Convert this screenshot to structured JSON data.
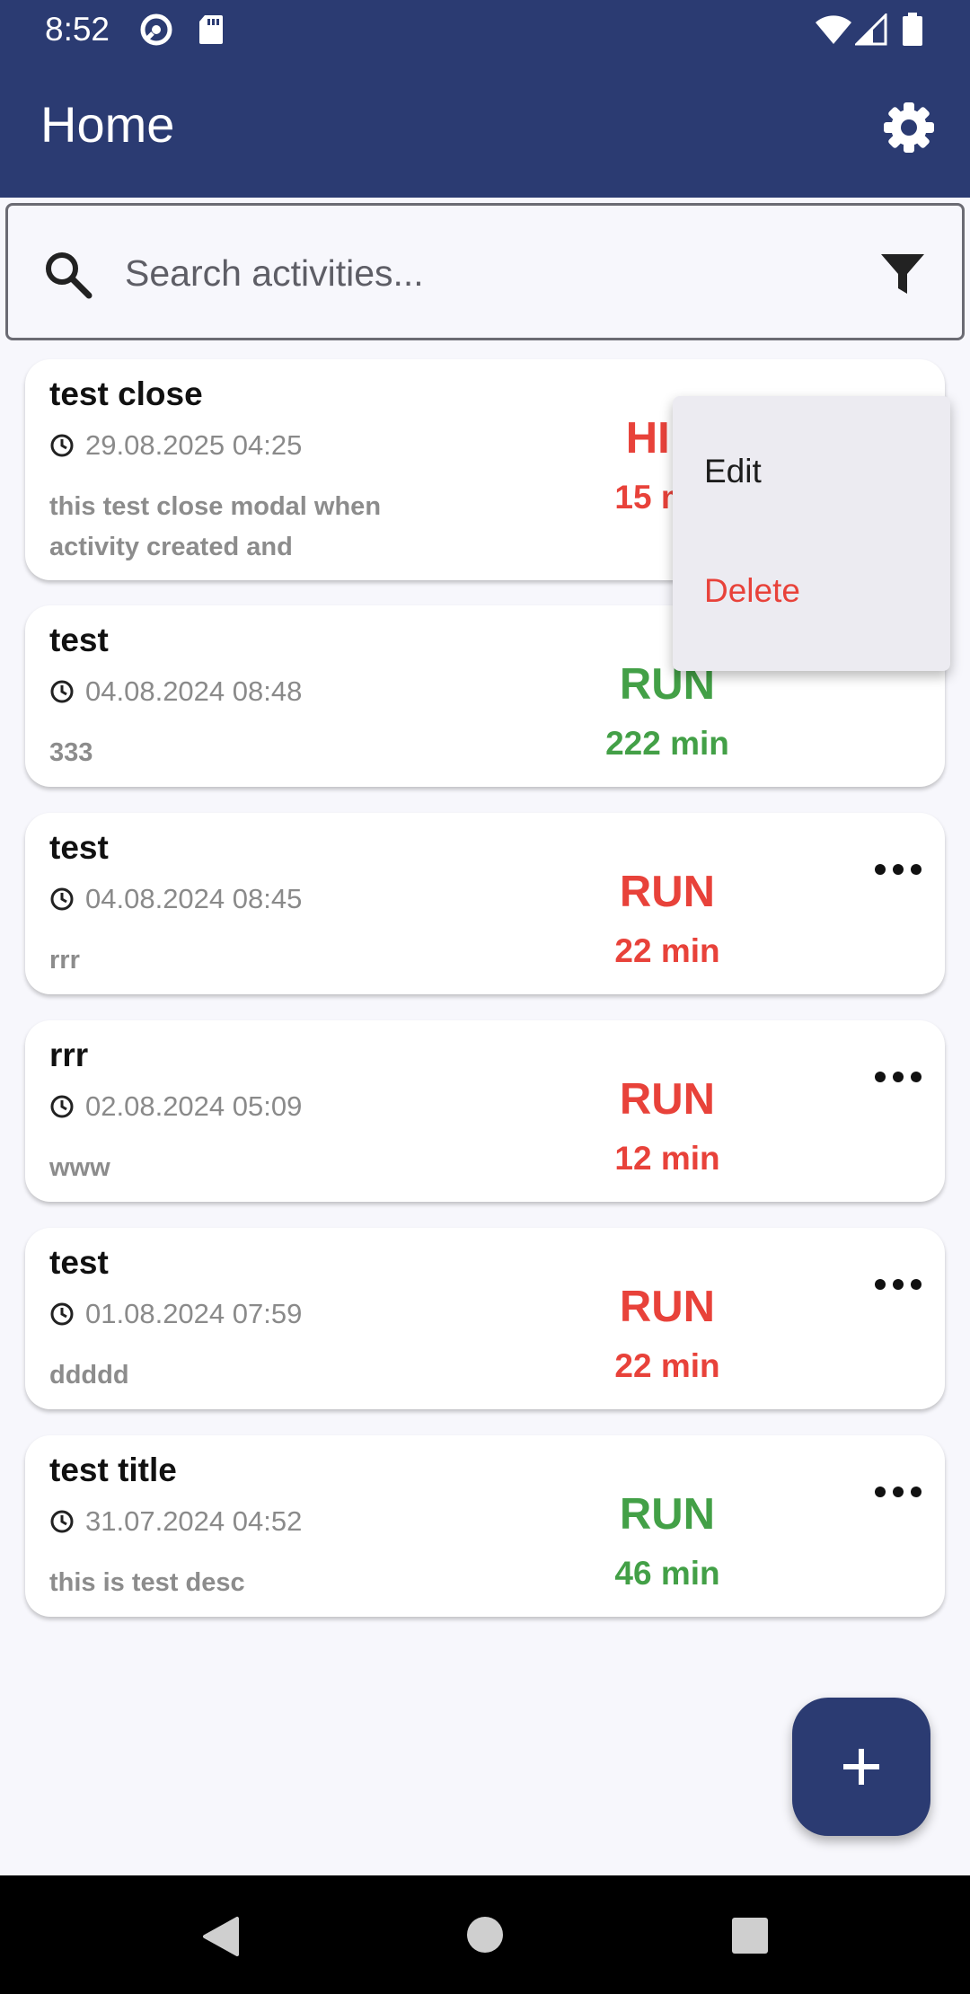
{
  "status_bar": {
    "time": "8:52",
    "icons": [
      "at-sign-icon",
      "sd-card-icon",
      "wifi-icon",
      "signal-icon",
      "battery-icon"
    ]
  },
  "app_bar": {
    "title": "Home",
    "settings_icon": "gear-icon"
  },
  "search": {
    "placeholder": "Search activities...",
    "value": "",
    "search_icon": "search-icon",
    "filter_icon": "filter-icon"
  },
  "activities": [
    {
      "title": "test close",
      "date": "29.08.2025 04:25",
      "description": "this test close modal when activity created and",
      "type": "HIIT",
      "duration": "15 min",
      "color": "#e8423a"
    },
    {
      "title": "test",
      "date": "04.08.2024 08:48",
      "description": "333",
      "type": "RUN",
      "duration": "222 min",
      "color": "#43a047"
    },
    {
      "title": "test",
      "date": "04.08.2024 08:45",
      "description": "rrr",
      "type": "RUN",
      "duration": "22 min",
      "color": "#e8423a"
    },
    {
      "title": "rrr",
      "date": "02.08.2024 05:09",
      "description": "www",
      "type": "RUN",
      "duration": "12 min",
      "color": "#e8423a"
    },
    {
      "title": "test",
      "date": "01.08.2024 07:59",
      "description": "ddddd",
      "type": "RUN",
      "duration": "22 min",
      "color": "#e8423a"
    },
    {
      "title": "test title",
      "date": "31.07.2024 04:52",
      "description": "this is test desc",
      "type": "RUN",
      "duration": "46 min",
      "color": "#43a047"
    }
  ],
  "context_menu": {
    "edit_label": "Edit",
    "delete_label": "Delete"
  },
  "fab": {
    "icon": "plus-icon"
  },
  "colors": {
    "primary": "#2b3b72",
    "red": "#e8423a",
    "green": "#43a047",
    "background": "#f7f7fc"
  }
}
